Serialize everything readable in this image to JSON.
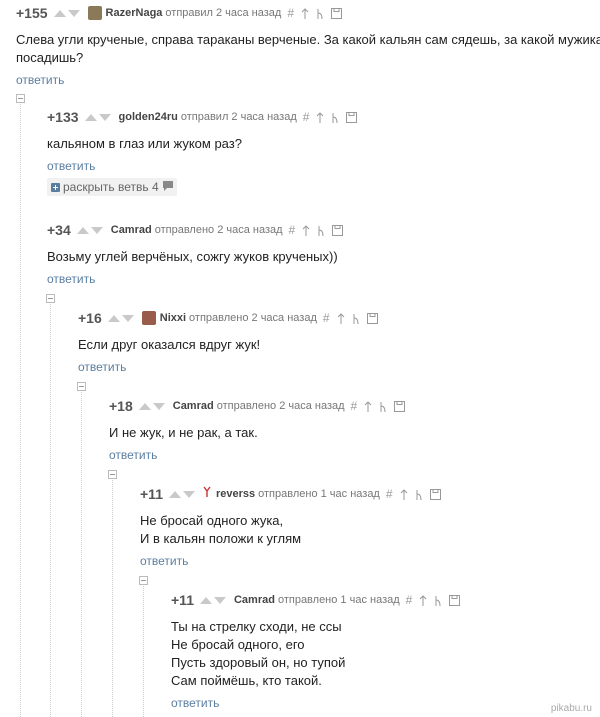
{
  "comments": [
    {
      "rating": "+155",
      "author": "RazerNaga",
      "meta": "отправил 2 часа назад",
      "avatar_color": "#8a7a5a",
      "lines": [
        "Слева угли крученые, справа тараканы верченые. За какой кальян сам сядешь, за какой мужика",
        "посадишь?"
      ],
      "reply": "ответить"
    },
    {
      "rating": "+133",
      "author": "golden24ru",
      "meta": "отправил 2 часа назад",
      "avatar_color": "",
      "lines": [
        "кальяном в глаз или жуком раз?"
      ],
      "reply": "ответить"
    },
    {
      "rating": "+34",
      "author": "Camrad",
      "meta": "отправлено 2 часа назад",
      "avatar_color": "",
      "lines": [
        "Возьму углей верчёных, сожгу жуков крученых))"
      ],
      "reply": "ответить"
    },
    {
      "rating": "+16",
      "author": "Nixxi",
      "meta": "отправлено 2 часа назад",
      "avatar_color": "#9a5c4a",
      "lines": [
        "Если друг оказался вдруг жук!"
      ],
      "reply": "ответить"
    },
    {
      "rating": "+18",
      "author": "Camrad",
      "meta": "отправлено 2 часа назад",
      "avatar_color": "",
      "lines": [
        "И не жук, и не рак, а так."
      ],
      "reply": "ответить"
    },
    {
      "rating": "+11",
      "author": "reverss",
      "meta": "отправлено 1 час назад",
      "avatar_color": "",
      "lines": [
        "Не бросай одного жука,",
        "И в кальян положи к углям"
      ],
      "reply": "ответить"
    },
    {
      "rating": "+11",
      "author": "Camrad",
      "meta": "отправлено 1 час назад",
      "avatar_color": "",
      "lines": [
        "Ты на стрелку сходи, не ссы",
        "Не бросай одного, его",
        "Пусть здоровый он, но тупой",
        "Сам поймёшь, кто такой."
      ],
      "reply": "ответить"
    }
  ],
  "branch": {
    "label": "раскрыть ветвь 4"
  },
  "tools": {
    "hash": "#"
  },
  "watermark": "pikabu.ru"
}
